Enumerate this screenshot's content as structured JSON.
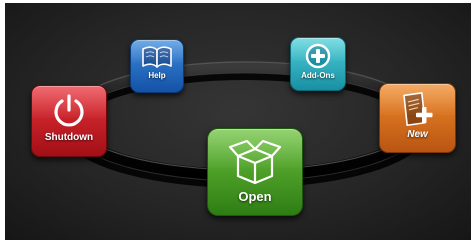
{
  "menu": {
    "items": [
      {
        "label": "Help",
        "icon": "book-icon",
        "color": "#1f63b8"
      },
      {
        "label": "Add-Ons",
        "icon": "plus-circle-icon",
        "color": "#22a7b8"
      },
      {
        "label": "Shutdown",
        "icon": "power-icon",
        "color": "#c4161e"
      },
      {
        "label": "New",
        "icon": "new-document-icon",
        "color": "#d86d1c"
      },
      {
        "label": "Open",
        "icon": "open-box-icon",
        "color": "#43a021"
      }
    ]
  }
}
